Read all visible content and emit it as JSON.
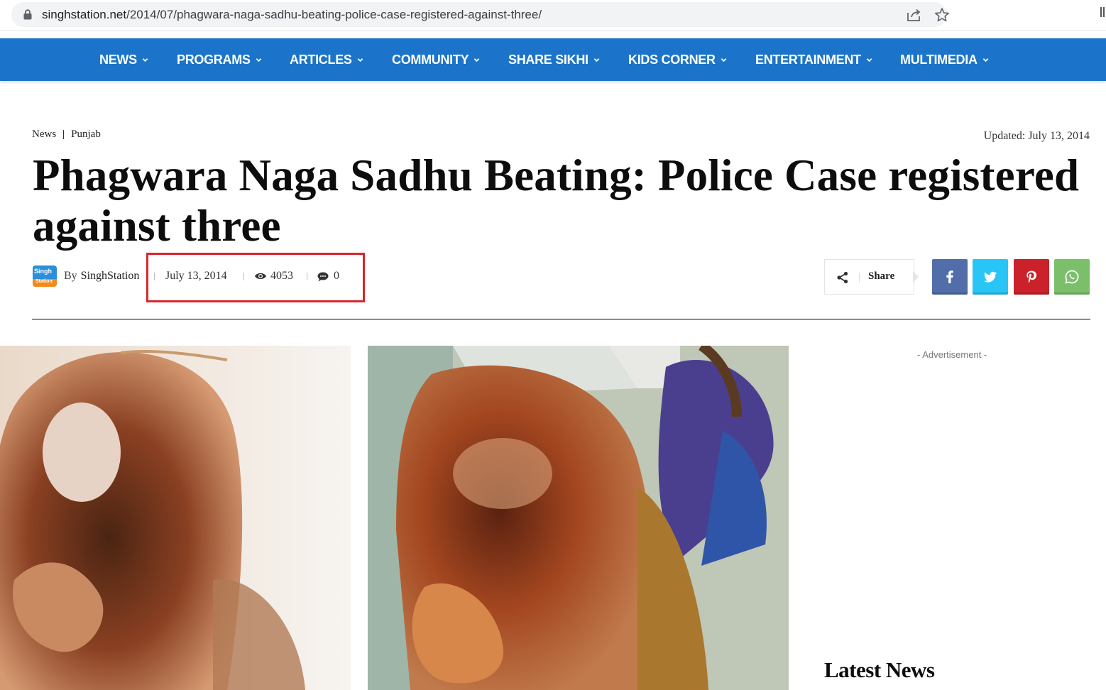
{
  "browser": {
    "url_host": "singhstation.net",
    "url_path": "/2014/07/phagwara-naga-sadhu-beating-police-case-registered-against-three/"
  },
  "nav": {
    "items": [
      {
        "label": "NEWS"
      },
      {
        "label": "PROGRAMS"
      },
      {
        "label": "ARTICLES"
      },
      {
        "label": "COMMUNITY"
      },
      {
        "label": "SHARE SIKHI"
      },
      {
        "label": "KIDS CORNER"
      },
      {
        "label": "ENTERTAINMENT"
      },
      {
        "label": "MULTIMEDIA"
      }
    ],
    "background_color": "#1b74c9"
  },
  "breadcrumb": {
    "items": [
      "News",
      "Punjab"
    ]
  },
  "updated": "Updated: July 13, 2014",
  "article": {
    "title": "Phagwara Naga Sadhu Beating: Police Case registered against three",
    "author_prefix": "By",
    "author": "SinghStation",
    "date": "July 13, 2014",
    "views": "4053",
    "comments": "0"
  },
  "share": {
    "label": "Share",
    "buttons": [
      {
        "name": "facebook",
        "color": "#516eab",
        "icon": "facebook-icon"
      },
      {
        "name": "twitter",
        "color": "#29c5f6",
        "icon": "twitter-icon"
      },
      {
        "name": "pinterest",
        "color": "#ca212a",
        "icon": "pinterest-icon"
      },
      {
        "name": "whatsapp",
        "color": "#7bbf6a",
        "icon": "whatsapp-icon"
      }
    ]
  },
  "highlight_color": "#d9262c",
  "sidebar": {
    "advertisement": "- Advertisement -",
    "latest_heading": "Latest News"
  }
}
